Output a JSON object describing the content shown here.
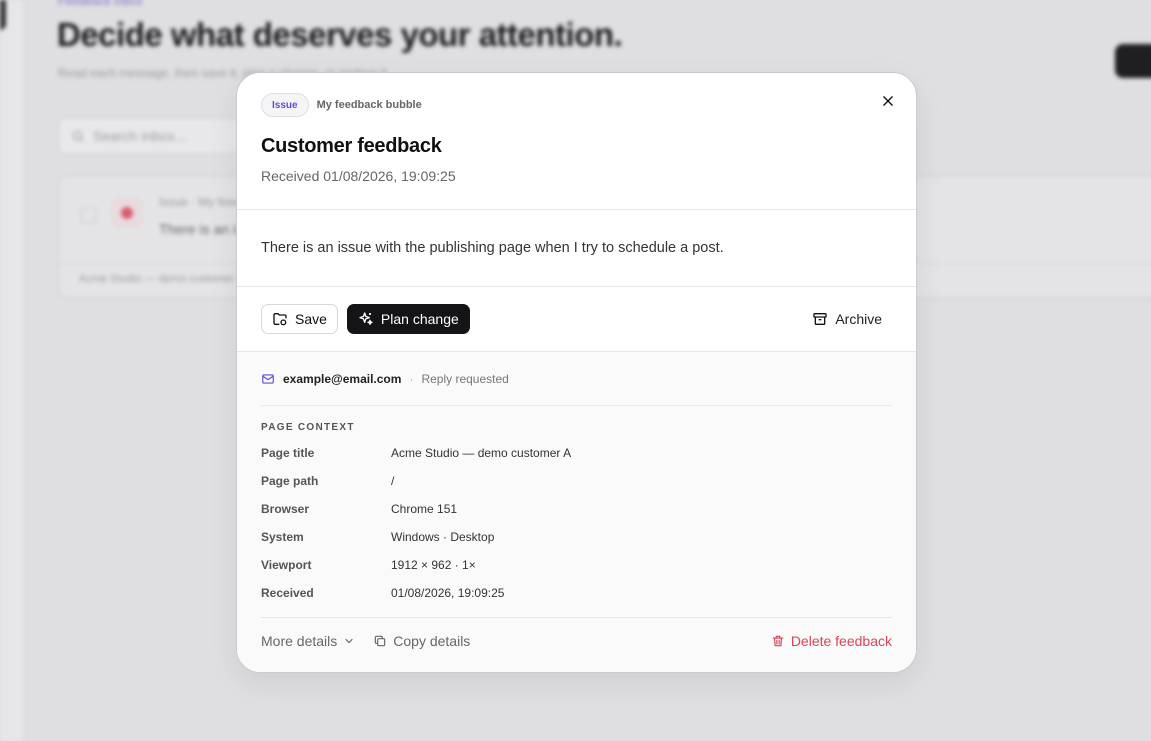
{
  "background": {
    "breadcrumb": "Feedback inbox",
    "heading": "Decide what deserves your attention.",
    "subheading": "Read each message, then save it, plan a change, or archive it.",
    "search_placeholder": "Search inbox...",
    "card_meta": "Issue · My feedback bubble",
    "card_preview": "There is an issue with the publishing page when I try to schedule a post.",
    "card_footer": "Acme Studio — demo customer A"
  },
  "modal": {
    "tag": "Issue",
    "source": "My feedback bubble",
    "title": "Customer feedback",
    "received_line": "Received 01/08/2026, 19:09:25",
    "message": "There is an issue with the publishing page when I try to schedule a post.",
    "actions": {
      "save": "Save",
      "plan_change": "Plan change",
      "archive": "Archive"
    },
    "contact": {
      "email": "example@email.com",
      "separator": "·",
      "status": "Reply requested"
    },
    "section_label": "PAGE CONTEXT",
    "context": [
      {
        "key": "Page title",
        "value": "Acme Studio — demo customer A"
      },
      {
        "key": "Page path",
        "value": "/"
      },
      {
        "key": "Browser",
        "value": "Chrome 151"
      },
      {
        "key": "System",
        "value": "Windows · Desktop"
      },
      {
        "key": "Viewport",
        "value": "1912 × 962 · 1×"
      },
      {
        "key": "Received",
        "value": "01/08/2026, 19:09:25"
      }
    ],
    "footer": {
      "more_details": "More details",
      "copy_details": "Copy details",
      "delete": "Delete feedback"
    }
  },
  "colors": {
    "accent": "#5b4fd6",
    "danger": "#d64556",
    "dark_button": "#141416"
  },
  "icons": {
    "close": "close-icon",
    "save": "folder-save-icon",
    "plan": "sparkles-icon",
    "archive": "archive-box-icon",
    "email": "mail-icon",
    "chevron": "chevron-down-icon",
    "copy": "copy-icon",
    "delete": "trash-icon"
  }
}
